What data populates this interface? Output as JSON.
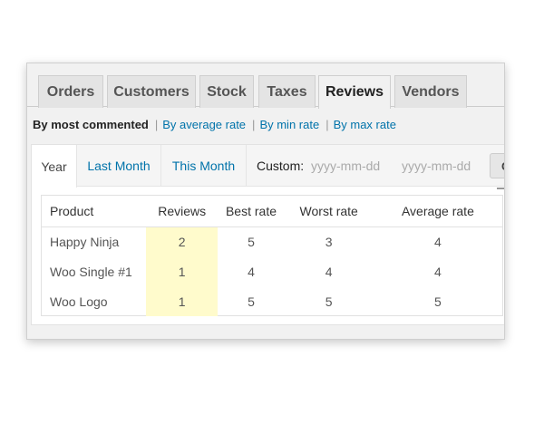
{
  "tabs": [
    "Orders",
    "Customers",
    "Stock",
    "Taxes",
    "Reviews",
    "Vendors"
  ],
  "active_tab": "Reviews",
  "sort": {
    "current": "By most commented",
    "links": [
      "By average rate",
      "By min rate",
      "By max rate"
    ]
  },
  "ranges": {
    "items": [
      "Year",
      "Last Month",
      "This Month"
    ],
    "active": "Year",
    "custom_label": "Custom:",
    "start_placeholder": "yyyy-mm-dd",
    "end_placeholder": "yyyy-mm-dd",
    "go_label": "G"
  },
  "table": {
    "headers": [
      "Product",
      "Reviews",
      "Best rate",
      "Worst rate",
      "Average rate"
    ],
    "rows": [
      [
        "Happy Ninja",
        "2",
        "5",
        "3",
        "4"
      ],
      [
        "Woo Single #1",
        "1",
        "4",
        "4",
        "4"
      ],
      [
        "Woo Logo",
        "1",
        "5",
        "5",
        "5"
      ]
    ],
    "highlight_color": "#fffbcc"
  },
  "colors": {
    "link": "#0073aa",
    "accent_highlight": "#fffbcc"
  }
}
